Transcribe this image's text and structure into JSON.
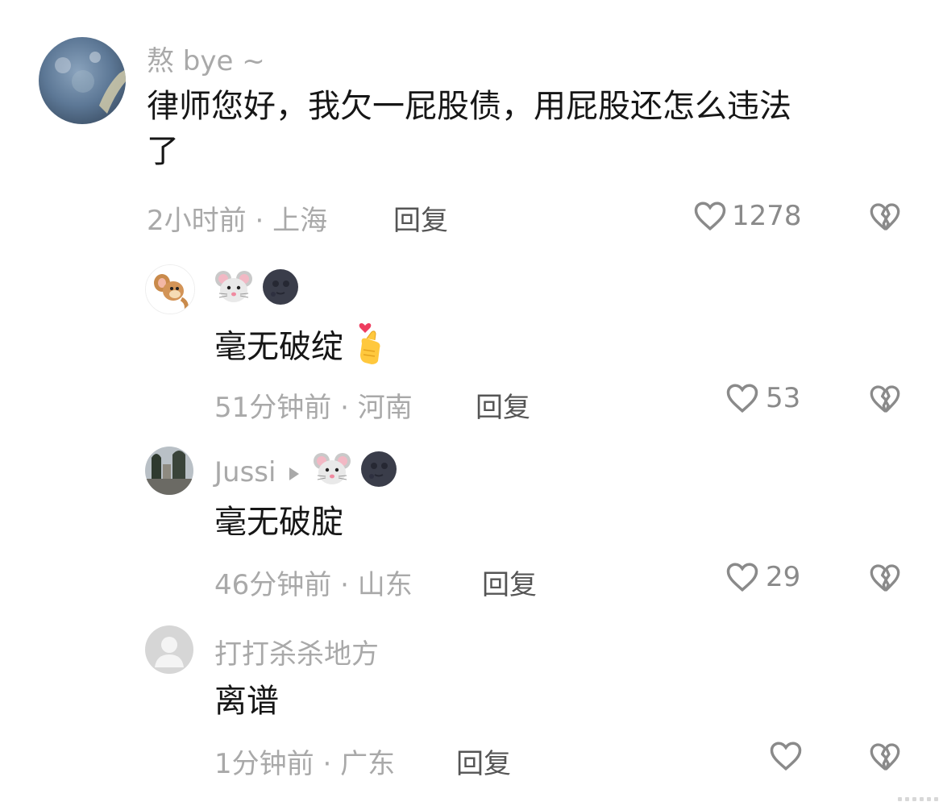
{
  "comments": [
    {
      "username": "熬 bye ~",
      "text_lines": [
        "律师您好，我欠一屁股债，用屁股还怎么违法",
        "了"
      ],
      "time": "2小时前",
      "location": "上海",
      "reply_label": "回复",
      "likes": "1278",
      "avatar_icon": "earth-photo-avatar"
    },
    {
      "username": "",
      "username_emojis": [
        "mouse-face-icon",
        "new-moon-face-icon"
      ],
      "text": "毫无破绽",
      "text_emoji": "heart-hands-icon",
      "time": "51分钟前",
      "location": "河南",
      "reply_label": "回复",
      "likes": "53",
      "avatar_icon": "cartoon-mouse-avatar"
    },
    {
      "username": "Jussi",
      "username_emojis": [
        "play-arrow-icon",
        "mouse-face-icon",
        "new-moon-face-icon"
      ],
      "text": "毫无破腚",
      "time": "46分钟前",
      "location": "山东",
      "reply_label": "回复",
      "likes": "29",
      "avatar_icon": "street-photo-avatar"
    },
    {
      "username": "打打杀杀地方",
      "text": "离谱",
      "time": "1分钟前",
      "location": "广东",
      "reply_label": "回复",
      "likes": "",
      "avatar_icon": "default-user-avatar"
    }
  ],
  "colors": {
    "meta_gray": "#a9a9a9",
    "text_dark": "#161616",
    "reply_gray": "#555555"
  }
}
